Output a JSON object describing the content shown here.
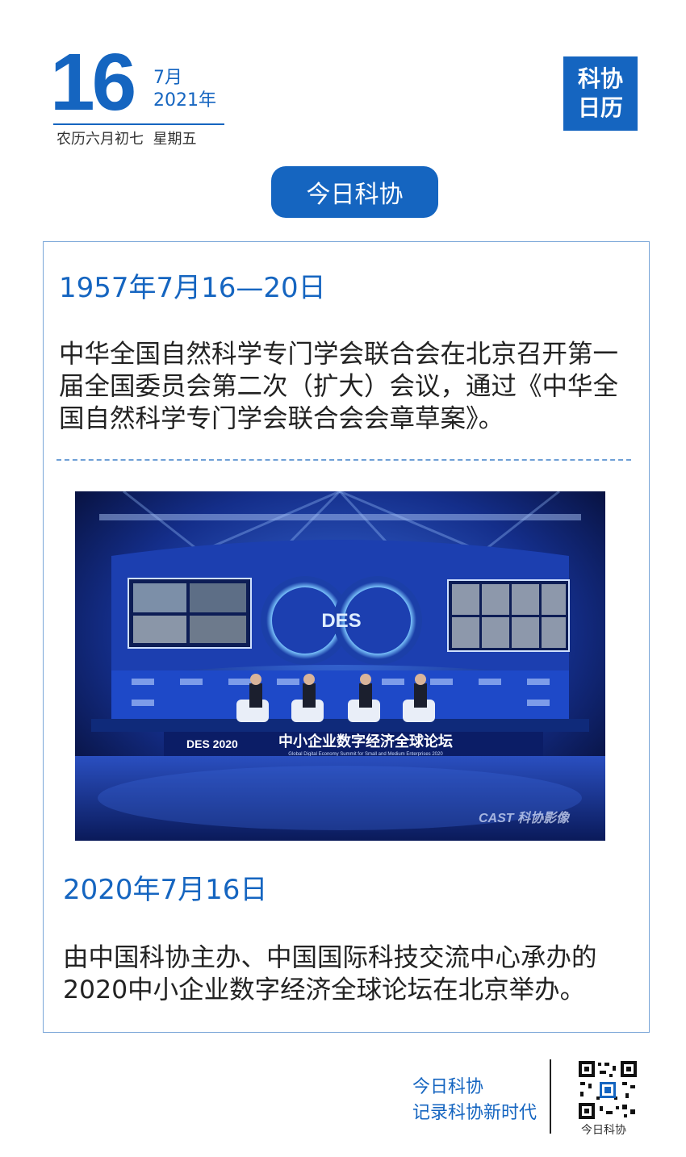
{
  "header": {
    "day": "16",
    "month": "7月",
    "year": "2021年",
    "lunar": "农历六月初七  星期五",
    "brand_line1": "科协",
    "brand_line2": "日历"
  },
  "section_label": "今日科协",
  "events": [
    {
      "date": "1957年7月16—20日",
      "text": "中华全国自然科学专门学会联合会在北京召开第一届全国委员会第二次（扩大）会议，通过《中华全国自然科学专门学会联合会会章草案》。"
    },
    {
      "date": "2020年7月16日",
      "text": "由中国科协主办、中国国际科技交流中心承办的2020中小企业数字经济全球论坛在北京举办。"
    }
  ],
  "photo": {
    "stage_banner_left": "DES 2020",
    "stage_banner": "中小企业数字经济全球论坛",
    "stage_banner_en": "Global Digital Economy Summit for Small and Medium Enterprises 2020",
    "watermark": "CAST 科协影像",
    "screen_logo": "DES"
  },
  "footer": {
    "line1": "今日科协",
    "line2": "记录科协新时代",
    "qr_label": "今日科协"
  },
  "colors": {
    "accent": "#1565c0",
    "card_border": "#7aa6d8"
  }
}
